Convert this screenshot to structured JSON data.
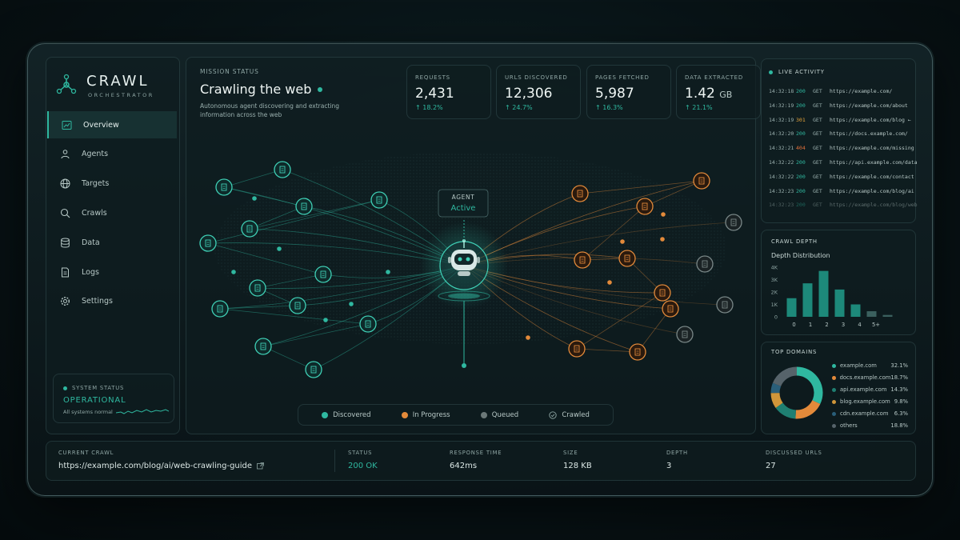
{
  "app": {
    "title": "CRAWL",
    "subtitle": "ORCHESTRATOR"
  },
  "sidebar": {
    "items": [
      {
        "label": "Overview",
        "icon": "chart-icon",
        "active": true
      },
      {
        "label": "Agents",
        "icon": "users-icon"
      },
      {
        "label": "Targets",
        "icon": "globe-icon"
      },
      {
        "label": "Crawls",
        "icon": "search-icon"
      },
      {
        "label": "Data",
        "icon": "database-icon"
      },
      {
        "label": "Logs",
        "icon": "document-icon"
      },
      {
        "label": "Settings",
        "icon": "gear-icon"
      }
    ],
    "system_status": {
      "label": "SYSTEM STATUS",
      "value": "OPERATIONAL",
      "note": "All systems normal"
    }
  },
  "mission": {
    "label": "MISSION STATUS",
    "title": "Crawling the web",
    "description_line1": "Autonomous agent discovering and extracting",
    "description_line2": "information across the web"
  },
  "stats": [
    {
      "label": "REQUESTS",
      "value": "2,431",
      "unit": "",
      "delta": "↑ 18.2%"
    },
    {
      "label": "URLS DISCOVERED",
      "value": "12,306",
      "unit": "",
      "delta": "↑ 24.7%"
    },
    {
      "label": "PAGES FETCHED",
      "value": "5,987",
      "unit": "",
      "delta": "↑ 16.3%"
    },
    {
      "label": "DATA EXTRACTED",
      "value": "1.42",
      "unit": "GB",
      "delta": "↑ 21.1%"
    }
  ],
  "agent": {
    "label": "AGENT",
    "status": "Active"
  },
  "legend": [
    {
      "label": "Discovered",
      "color": "#2fb8a0"
    },
    {
      "label": "In Progress",
      "color": "#e38a3a"
    },
    {
      "label": "Queued",
      "color": "#6b7878"
    },
    {
      "label": "Crawled",
      "icon": "check-icon"
    }
  ],
  "activity": {
    "title": "LIVE ACTIVITY",
    "rows": [
      {
        "time": "14:32:18",
        "code": "200",
        "method": "GET",
        "url": "https://example.com/"
      },
      {
        "time": "14:32:19",
        "code": "200",
        "method": "GET",
        "url": "https://example.com/about"
      },
      {
        "time": "14:32:19",
        "code": "301",
        "method": "GET",
        "url": "https://example.com/blog ←"
      },
      {
        "time": "14:32:20",
        "code": "200",
        "method": "GET",
        "url": "https://docs.example.com/"
      },
      {
        "time": "14:32:21",
        "code": "404",
        "method": "GET",
        "url": "https://example.com/missing"
      },
      {
        "time": "14:32:22",
        "code": "200",
        "method": "GET",
        "url": "https://api.example.com/data"
      },
      {
        "time": "14:32:22",
        "code": "200",
        "method": "GET",
        "url": "https://example.com/contact"
      },
      {
        "time": "14:32:23",
        "code": "200",
        "method": "GET",
        "url": "https://example.com/blog/ai"
      },
      {
        "time": "14:32:23",
        "code": "200",
        "method": "GET",
        "url": "https://example.com/blog/web"
      }
    ]
  },
  "chart_data": [
    {
      "type": "bar",
      "title": "CRAWL DEPTH",
      "subtitle": "Depth Distribution",
      "categories": [
        "0",
        "1",
        "2",
        "3",
        "4",
        "5+"
      ],
      "values": [
        1500,
        2700,
        3700,
        2200,
        1000,
        450,
        150
      ],
      "y_ticks": [
        "4K",
        "3K",
        "2K",
        "1K",
        "0"
      ],
      "ylim": [
        0,
        4000
      ]
    },
    {
      "type": "pie",
      "title": "TOP DOMAINS",
      "labels": [
        "example.com",
        "docs.example.com",
        "api.example.com",
        "blog.example.com",
        "cdn.example.com",
        "others"
      ],
      "values": [
        32.1,
        18.7,
        14.3,
        9.8,
        6.3,
        18.8
      ],
      "display": [
        "32.1%",
        "18.7%",
        "14.3%",
        "9.8%",
        "6.3%",
        "18.8%"
      ],
      "colors": [
        "#2fb8a0",
        "#e38a3a",
        "#1f7f72",
        "#d0963a",
        "#2a5f7a",
        "#56636a"
      ]
    }
  ],
  "current": {
    "crawl_label": "CURRENT CRAWL",
    "url": "https://example.com/blog/ai/web-crawling-guide",
    "status_label": "STATUS",
    "status": "200 OK",
    "response_label": "RESPONSE TIME",
    "response": "642ms",
    "size_label": "SIZE",
    "size": "128 KB",
    "depth_label": "DEPTH",
    "depth": "3",
    "discussed_label": "DISCUSSED URLS",
    "discussed": "27"
  },
  "colors": {
    "accent": "#2fb8a0",
    "warn": "#e38a3a",
    "error": "#e0703a",
    "muted": "#6b7878"
  }
}
